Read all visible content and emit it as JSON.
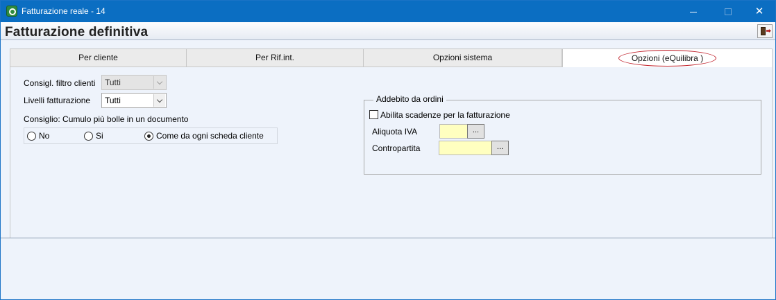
{
  "window": {
    "title": "Fatturazione reale - 14",
    "controls": {
      "minimize_icon": "minimize-icon",
      "maximize_icon": "maximize-icon",
      "close_icon": "close-icon",
      "close_glyph": "✕"
    }
  },
  "header": {
    "title": "Fatturazione definitiva",
    "exit_icon": "exit-door-icon"
  },
  "tabs": [
    {
      "label": "Per cliente",
      "active": false
    },
    {
      "label": "Per Rif.int.",
      "active": false
    },
    {
      "label": "Opzioni sistema",
      "active": false
    },
    {
      "label": "Opzioni (eQuilibra )",
      "active": true
    }
  ],
  "options": {
    "filtro_clienti": {
      "label": "Consigl. filtro clienti",
      "value": "Tutti",
      "enabled": false
    },
    "livelli_fatturazione": {
      "label": "Livelli fatturazione",
      "value": "Tutti",
      "enabled": true
    },
    "cumulo": {
      "label": "Consiglio: Cumulo più bolle in un documento",
      "options": [
        {
          "label": "No",
          "checked": false
        },
        {
          "label": "Si",
          "checked": false
        },
        {
          "label": "Come da ogni scheda cliente",
          "checked": true
        }
      ]
    }
  },
  "addebito": {
    "legend": "Addebito da ordini",
    "abilita_scadenze": {
      "label": "Abilita scadenze per la fatturazione",
      "checked": false
    },
    "aliquota_iva": {
      "label": "Aliquota IVA",
      "value": "",
      "button_label": "..."
    },
    "contropartita": {
      "label": "Contropartita",
      "value": "",
      "button_label": "..."
    }
  },
  "colors": {
    "titlebar": "#0b6ec2",
    "panel_bg": "#eef3fb",
    "field_bg": "#ffffc0",
    "highlight_oval": "#c0202a"
  }
}
